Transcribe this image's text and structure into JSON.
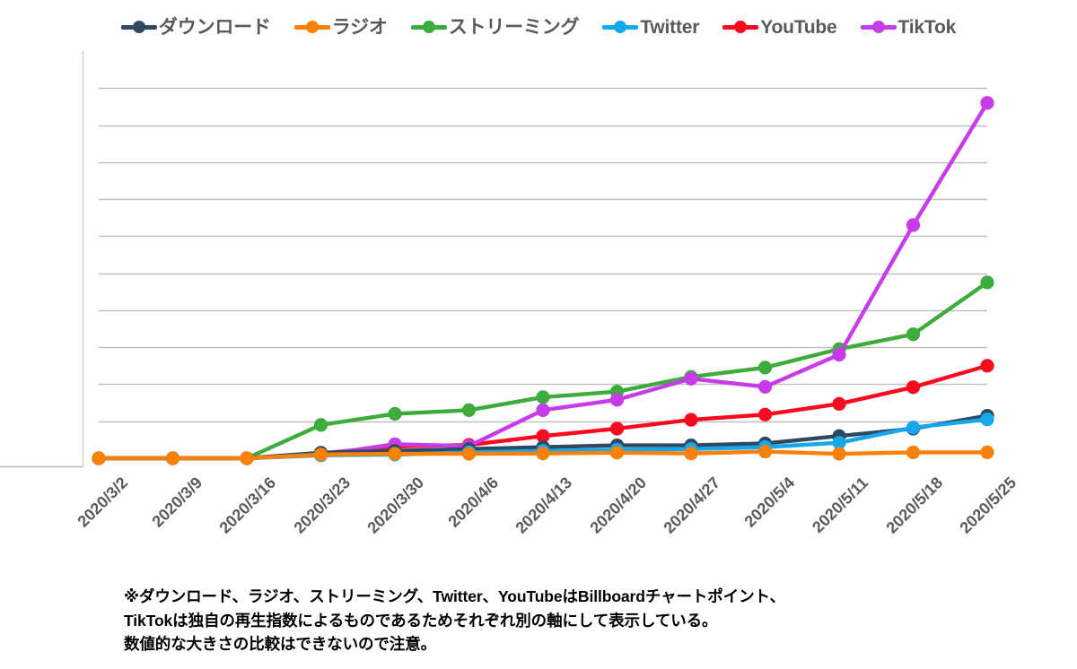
{
  "legend": {
    "position": "top-center",
    "items": [
      {
        "label": "ダウンロード",
        "color": "#2E4A62",
        "icon": "line-marker-icon"
      },
      {
        "label": "ラジオ",
        "color": "#F98009",
        "icon": "line-marker-icon"
      },
      {
        "label": "ストリーミング",
        "color": "#3DAC3D",
        "icon": "line-marker-icon"
      },
      {
        "label": "Twitter",
        "color": "#15A7EC",
        "icon": "line-marker-icon"
      },
      {
        "label": "YouTube",
        "color": "#FA0A1E",
        "icon": "line-marker-icon"
      },
      {
        "label": "TikTok",
        "color": "#C83BE8",
        "icon": "line-marker-icon"
      }
    ]
  },
  "caption": {
    "lines": [
      "※ダウンロード、ラジオ、ストリーミング、Twitter、YouTubeはBillboardチャートポイント、",
      "TikTokは独自の再生指数によるものであるためそれぞれ別の軸にして表示している。",
      "数値的な大きさの比較はできないので注意。"
    ]
  },
  "chart_data": {
    "type": "line",
    "title": "",
    "xlabel": "",
    "ylabel": "",
    "grid": true,
    "legend_position": "top-center",
    "ylim": [
      0,
      110
    ],
    "y_gridlines": [
      10,
      20,
      30,
      40,
      50,
      60,
      70,
      80,
      90,
      100
    ],
    "y_axis_labels_visible": false,
    "categories": [
      "2020/3/2",
      "2020/3/9",
      "2020/3/16",
      "2020/3/23",
      "2020/3/30",
      "2020/4/6",
      "2020/4/13",
      "2020/4/20",
      "2020/4/27",
      "2020/5/4",
      "2020/5/11",
      "2020/5/18",
      "2020/5/25"
    ],
    "series": [
      {
        "name": "ダウンロード",
        "color": "#2E4A62",
        "values": [
          0,
          0,
          0,
          1.5,
          2.0,
          2.5,
          3.0,
          3.5,
          3.5,
          4.0,
          6.0,
          8.0,
          11.5
        ]
      },
      {
        "name": "ラジオ",
        "color": "#F98009",
        "values": [
          0,
          0,
          0,
          1.0,
          1.2,
          1.2,
          1.3,
          1.5,
          1.3,
          1.8,
          1.2,
          1.6,
          1.6
        ]
      },
      {
        "name": "ストリーミング",
        "color": "#3DAC3D",
        "values": [
          0,
          0,
          0,
          9.0,
          12.0,
          13.0,
          16.5,
          18.0,
          22.0,
          24.5,
          29.5,
          33.5,
          47.5
        ]
      },
      {
        "name": "Twitter",
        "color": "#15A7EC",
        "values": [
          0,
          0,
          0,
          0.8,
          1.0,
          1.6,
          2.0,
          2.3,
          2.5,
          3.0,
          4.2,
          8.3,
          10.5
        ]
      },
      {
        "name": "YouTube",
        "color": "#FA0A1E",
        "values": [
          0,
          0,
          0,
          1.3,
          3.2,
          3.6,
          6.0,
          8.0,
          10.4,
          11.8,
          14.7,
          19.2,
          25.0
        ]
      },
      {
        "name": "TikTok",
        "color": "#C83BE8",
        "values": [
          0,
          0,
          0,
          0.9,
          3.8,
          3.3,
          13.0,
          15.8,
          21.5,
          19.3,
          28.0,
          63.0,
          96.0
        ]
      }
    ]
  },
  "axes": {
    "x_axis_line_color": "#B8B8B8",
    "y_axis_line_color": "#D0D0D0",
    "gridline_color": "#BFBFBF",
    "tick_label_color": "#5A5A5A",
    "tick_label_rotation_deg": -45
  }
}
